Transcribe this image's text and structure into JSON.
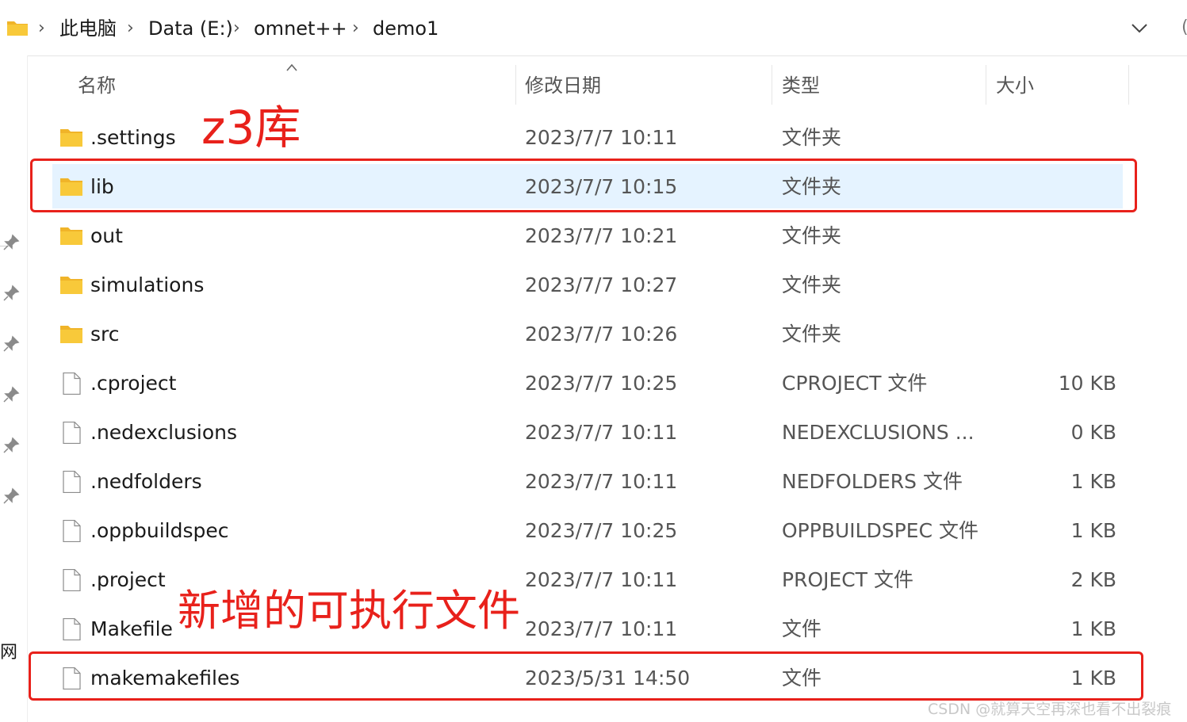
{
  "breadcrumb": {
    "items": [
      "此电脑",
      "Data (E:)",
      "omnet++",
      "demo1"
    ],
    "separator": "›"
  },
  "columns": {
    "name": "名称",
    "modified": "修改日期",
    "type": "类型",
    "size": "大小"
  },
  "files": [
    {
      "name": ".settings",
      "modified": "2023/7/7 10:11",
      "type": "文件夹",
      "size": "",
      "icon": "folder-icon"
    },
    {
      "name": "lib",
      "modified": "2023/7/7 10:15",
      "type": "文件夹",
      "size": "",
      "icon": "folder-icon",
      "selected": true
    },
    {
      "name": "out",
      "modified": "2023/7/7 10:21",
      "type": "文件夹",
      "size": "",
      "icon": "folder-icon"
    },
    {
      "name": "simulations",
      "modified": "2023/7/7 10:27",
      "type": "文件夹",
      "size": "",
      "icon": "folder-icon"
    },
    {
      "name": "src",
      "modified": "2023/7/7 10:26",
      "type": "文件夹",
      "size": "",
      "icon": "folder-icon"
    },
    {
      "name": ".cproject",
      "modified": "2023/7/7 10:25",
      "type": "CPROJECT 文件",
      "size": "10 KB",
      "icon": "file-icon"
    },
    {
      "name": ".nedexclusions",
      "modified": "2023/7/7 10:11",
      "type": "NEDEXCLUSIONS ...",
      "size": "0 KB",
      "icon": "file-icon"
    },
    {
      "name": ".nedfolders",
      "modified": "2023/7/7 10:11",
      "type": "NEDFOLDERS 文件",
      "size": "1 KB",
      "icon": "file-icon"
    },
    {
      "name": ".oppbuildspec",
      "modified": "2023/7/7 10:25",
      "type": "OPPBUILDSPEC 文件",
      "size": "1 KB",
      "icon": "file-icon"
    },
    {
      "name": ".project",
      "modified": "2023/7/7 10:11",
      "type": "PROJECT 文件",
      "size": "2 KB",
      "icon": "file-icon"
    },
    {
      "name": "Makefile",
      "modified": "2023/7/7 10:11",
      "type": "文件",
      "size": "1 KB",
      "icon": "file-icon"
    },
    {
      "name": "makemakefiles",
      "modified": "2023/5/31 14:50",
      "type": "文件",
      "size": "1 KB",
      "icon": "file-icon"
    }
  ],
  "annotations": {
    "z3_label": "z3库",
    "exec_label": "新增的可执行文件",
    "color": "#e8211b"
  },
  "nav": {
    "partial_char": "网"
  },
  "watermark": "CSDN @就算天空再深也看不出裂痕",
  "colors": {
    "selection": "#e5f3ff",
    "folder": "#f8c93a",
    "annotation": "#e8211b"
  }
}
